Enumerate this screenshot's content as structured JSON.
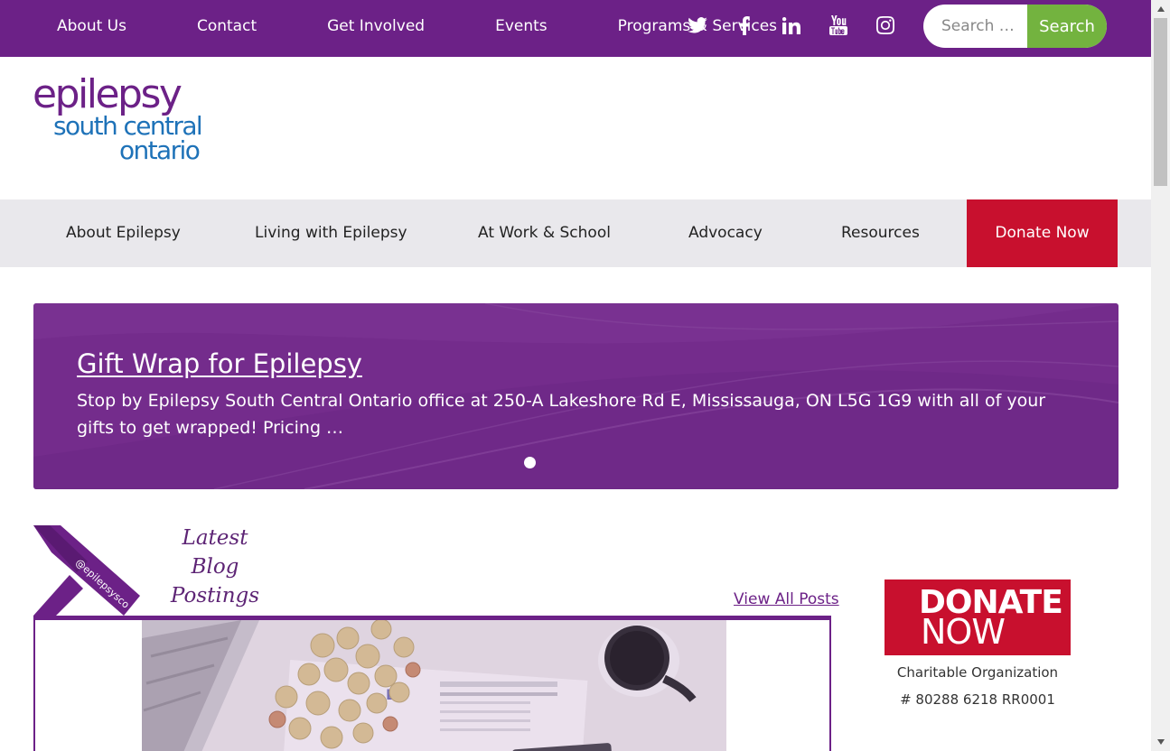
{
  "topbar": {
    "links": [
      "About Us",
      "Contact",
      "Get Involved",
      "Events",
      "Programs & Services"
    ],
    "social_icons": [
      "twitter-icon",
      "facebook-icon",
      "linkedin-icon",
      "youtube-icon",
      "instagram-icon"
    ],
    "search_placeholder": "Search …",
    "search_button": "Search"
  },
  "logo": {
    "line1": "epilepsy",
    "line2": "south central",
    "line3": "ontario"
  },
  "mainnav": {
    "items": [
      "About Epilepsy",
      "Living with Epilepsy",
      "At Work & School",
      "Advocacy",
      "Resources"
    ],
    "donate": "Donate Now"
  },
  "hero": {
    "title": "Gift Wrap for Epilepsy",
    "text": "Stop by Epilepsy South Central Ontario office at 250-A Lakeshore Rd E, Mississauga, ON L5G 1G9 with all of your gifts to get wrapped! Pricing …"
  },
  "blog": {
    "ribbon_text": "@epilepsysco",
    "heading_lines": [
      "Latest",
      "Blog",
      "Postings"
    ],
    "view_all": "View All Posts"
  },
  "sidebar": {
    "donate_line1": "DONATE",
    "donate_line2": "NOW",
    "charitable_label": "Charitable Organization",
    "charitable_number": "# 80288 6218 RR0001"
  },
  "colors": {
    "brand_purple": "#6c2187",
    "brand_blue": "#1e72b8",
    "donate_red": "#c8102e",
    "search_green": "#73b33f",
    "nav_gray": "#e9e8ec"
  }
}
